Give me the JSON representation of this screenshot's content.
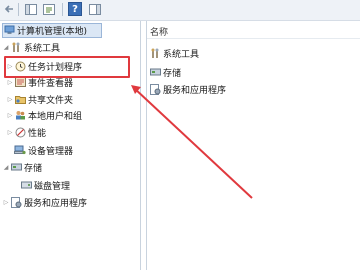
{
  "toolbar": {
    "buttons": [
      "back-arrow",
      "forward-arrow",
      "console-tree",
      "properties",
      "help",
      "show-hide"
    ],
    "help_label": "?"
  },
  "tree": {
    "root": "计算机管理(本地)",
    "items": [
      {
        "label": "系统工具",
        "icon": "tools-icon"
      },
      {
        "label": "任务计划程序",
        "icon": "clock-icon"
      },
      {
        "label": "事件查看器",
        "icon": "event-viewer-icon"
      },
      {
        "label": "共享文件夹",
        "icon": "shared-folder-icon"
      },
      {
        "label": "本地用户和组",
        "icon": "users-icon"
      },
      {
        "label": "性能",
        "icon": "performance-icon"
      },
      {
        "label": "设备管理器",
        "icon": "device-manager-icon"
      },
      {
        "label": "存储",
        "icon": "storage-icon"
      },
      {
        "label": "磁盘管理",
        "icon": "disk-icon"
      },
      {
        "label": "服务和应用程序",
        "icon": "services-icon"
      }
    ]
  },
  "list": {
    "column_header": "名称",
    "items": [
      {
        "label": "系统工具",
        "icon": "tools-icon"
      },
      {
        "label": "存储",
        "icon": "storage-icon"
      },
      {
        "label": "服务和应用程序",
        "icon": "services-icon"
      }
    ]
  },
  "colors": {
    "annotation": "#e0393e",
    "selection": "#dbe7f5"
  }
}
